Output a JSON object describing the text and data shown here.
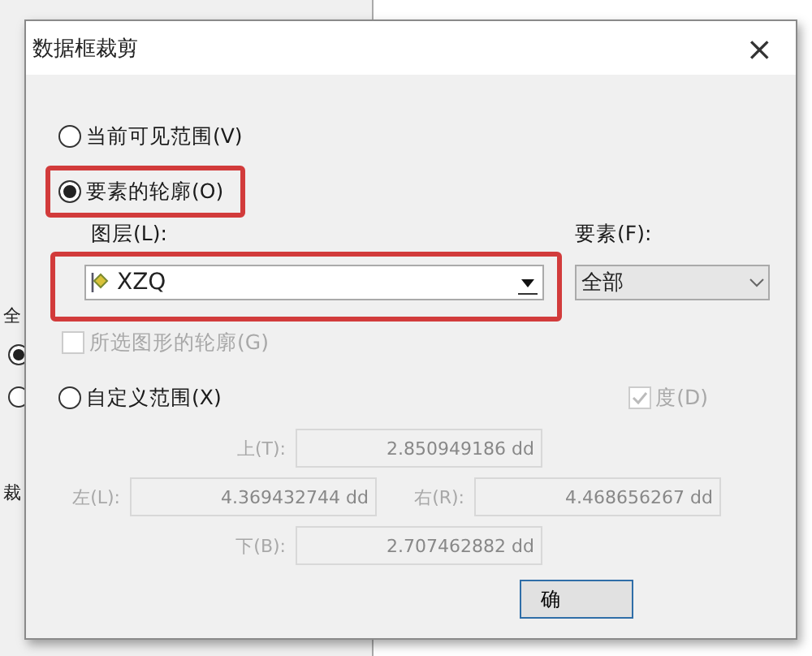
{
  "background": {
    "labels": [
      "全",
      "裁"
    ],
    "radios": [
      {
        "selected": true
      },
      {
        "selected": false
      }
    ]
  },
  "dialog": {
    "title": "数据框裁剪",
    "close": "×",
    "extent_options": [
      {
        "label": "当前可见范围(V)",
        "selected": false,
        "highlighted": false
      },
      {
        "label": "要素的轮廓(O)",
        "selected": true,
        "highlighted": true
      }
    ],
    "layer": {
      "label": "图层(L):",
      "value": "XZQ",
      "highlighted": true
    },
    "features": {
      "label": "要素(F):",
      "value": "全部"
    },
    "selected_graphics": {
      "label": "所选图形的轮廓(G)",
      "checked": false,
      "disabled": true
    },
    "custom_extent": {
      "label": "自定义范围(X)",
      "selected": false
    },
    "degrees": {
      "label": "度(D)",
      "checked": true,
      "disabled": true
    },
    "bounds": {
      "top": {
        "label": "上(T):",
        "value": "2.850949186 dd"
      },
      "left": {
        "label": "左(L):",
        "value": "4.369432744 dd"
      },
      "right": {
        "label": "右(R):",
        "value": "4.468656267 dd"
      },
      "bottom": {
        "label": "下(B):",
        "value": "2.707462882 dd"
      }
    },
    "buttons": [
      "确"
    ]
  }
}
